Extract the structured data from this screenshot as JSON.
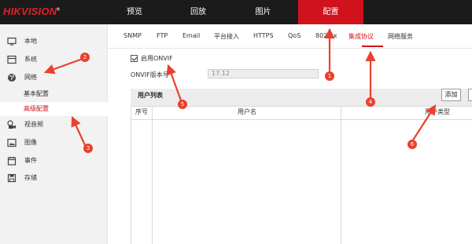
{
  "brand": {
    "logo_text": "HIKVISION"
  },
  "top_nav": [
    {
      "label": "预览",
      "active": false
    },
    {
      "label": "回放",
      "active": false
    },
    {
      "label": "图片",
      "active": false
    },
    {
      "label": "配置",
      "active": true
    }
  ],
  "sidebar": {
    "items": [
      {
        "label": "本地",
        "icon": "monitor-icon"
      },
      {
        "label": "系统",
        "icon": "system-icon"
      },
      {
        "label": "网络",
        "icon": "globe-icon"
      },
      {
        "label": "视音频",
        "icon": "video-audio-icon"
      },
      {
        "label": "图像",
        "icon": "image-icon"
      },
      {
        "label": "事件",
        "icon": "calendar-icon"
      },
      {
        "label": "存储",
        "icon": "save-icon"
      }
    ],
    "network_sub": [
      {
        "label": "基本配置",
        "active": false
      },
      {
        "label": "高级配置",
        "active": true
      }
    ]
  },
  "tabs": [
    {
      "label": "SNMP",
      "active": false
    },
    {
      "label": "FTP",
      "active": false
    },
    {
      "label": "Email",
      "active": false
    },
    {
      "label": "平台接入",
      "active": false
    },
    {
      "label": "HTTPS",
      "active": false
    },
    {
      "label": "QoS",
      "active": false
    },
    {
      "label": "802.1x",
      "active": false
    },
    {
      "label": "集成协议",
      "active": true
    },
    {
      "label": "网络服务",
      "active": false
    }
  ],
  "form": {
    "enable_onvif_label": "启用ONVIF",
    "enable_onvif_checked": true,
    "onvif_version_label": "ONVIF版本号",
    "onvif_version_value": "17.12"
  },
  "user_list": {
    "title": "用户列表",
    "add_button": "添加",
    "columns": [
      "序号",
      "用户名",
      "用户类型"
    ],
    "rows": []
  },
  "annotations": {
    "color": "#e8412e",
    "badges": [
      "1",
      "2",
      "3",
      "4",
      "5",
      "6"
    ]
  },
  "colors": {
    "accent": "#d0121c",
    "topbar": "#1b1b1b",
    "sidebar": "#f2f2f2"
  }
}
